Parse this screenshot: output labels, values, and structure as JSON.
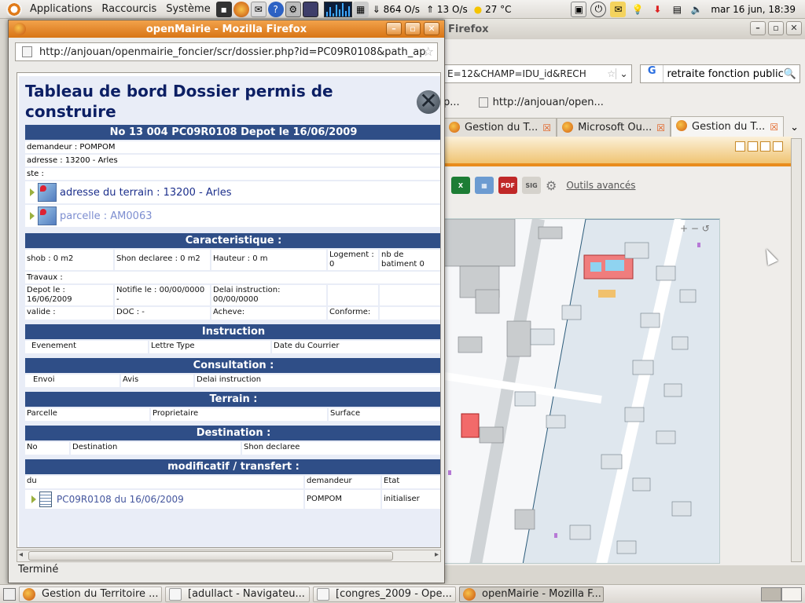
{
  "top_panel": {
    "menus": [
      "Applications",
      "Raccourcis",
      "Système"
    ],
    "net_down": "864 O/s",
    "net_up": "13 O/s",
    "weather": "27 °C",
    "clock": "mar 16 jun, 18:39"
  },
  "background_window": {
    "title": "Firefox",
    "url": "E=12&CHAMP=IDU_id&RECH",
    "search_value": "retraite fonction public",
    "bookmarks": [
      "p...",
      "http://anjouan/open..."
    ],
    "tabs": [
      {
        "label": "Gestion du T...",
        "active": false
      },
      {
        "label": "Microsoft Ou...",
        "active": false
      },
      {
        "label": "Gestion du T...",
        "active": true
      }
    ],
    "toolbar": {
      "outils_label": "Outils avancés",
      "pdf": "PDF",
      "sig": "SIG"
    }
  },
  "popup": {
    "title": "openMairie - Mozilla Firefox",
    "url": "http://anjouan/openmairie_foncier/scr/dossier.php?id=PC09R0108&path_ap",
    "status": "Terminé",
    "dashboard": {
      "title": "Tableau de bord Dossier permis de construire",
      "dossier_bar": "No 13 004 PC09R0108 Depot le 16/06/2009",
      "demandeur": "demandeur : POMPOM",
      "adresse": "adresse : 13200 - Arles",
      "ste": "ste :",
      "terrain_link": "adresse du terrain : 13200 - Arles",
      "parcelle_link": "parcelle : AM0063",
      "carac_title": "Caracteristique :",
      "carac_row1": [
        "shob : 0 m2",
        "Shon declaree : 0 m2",
        "Hauteur : 0 m",
        "Logement : 0",
        "nb de batiment 0"
      ],
      "travaux": "Travaux :",
      "carac_row2": [
        "Depot le : 16/06/2009",
        "Notifie le : 00/00/0000 -",
        "Delai instruction: 00/00/0000",
        "",
        ""
      ],
      "carac_row3": [
        "valide :",
        "DOC : -",
        "Acheve:",
        "Conforme:",
        ""
      ],
      "instruction_title": "Instruction",
      "instruction_cols": [
        "Evenement",
        "Lettre Type",
        "Date du Courrier"
      ],
      "consultation_title": "Consultation :",
      "consultation_cols": [
        "Envoi",
        "Avis",
        "Delai instruction"
      ],
      "terrain_title": "Terrain :",
      "terrain_cols": [
        "Parcelle",
        "Proprietaire",
        "Surface"
      ],
      "destination_title": "Destination :",
      "destination_cols": [
        "No",
        "Destination",
        "Shon declaree"
      ],
      "modif_title": "modificatif / transfert :",
      "modif_cols": [
        "du",
        "demandeur",
        "Etat"
      ],
      "modif_row": {
        "link": "PC09R0108 du 16/06/2009",
        "demandeur": "POMPOM",
        "etat": "initialiser"
      }
    }
  },
  "taskbar": {
    "tasks": [
      {
        "label": "Gestion du Territoire ...",
        "active": false
      },
      {
        "label": "[adullact - Navigateu...",
        "active": false
      },
      {
        "label": "[congres_2009 - Ope...",
        "active": false
      },
      {
        "label": "openMairie - Mozilla F...",
        "active": true
      }
    ]
  }
}
